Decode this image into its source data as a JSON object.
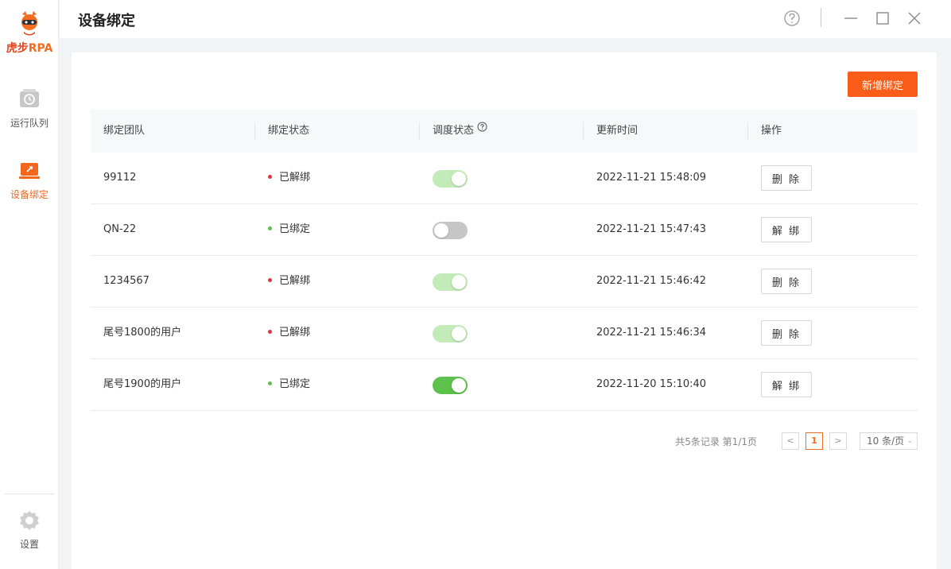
{
  "app": {
    "logo_text_a": "虎步",
    "logo_text_b": "RPA"
  },
  "sidebar": {
    "items": [
      {
        "label": "运行队列",
        "icon": "clock-icon"
      },
      {
        "label": "设备绑定",
        "icon": "laptop-icon",
        "active": true
      }
    ],
    "settings_label": "设置"
  },
  "header": {
    "title": "设备绑定"
  },
  "toolbar": {
    "add_label": "新增绑定"
  },
  "table": {
    "columns": [
      "绑定团队",
      "绑定状态",
      "调度状态",
      "更新时间",
      "操作"
    ],
    "rows": [
      {
        "team": "99112",
        "status": "已解绑",
        "status_color": "#e5323e",
        "schedule": "on-disabled",
        "updated": "2022-11-21 15:48:09",
        "action": "删 除"
      },
      {
        "team": "QN-22",
        "status": "已绑定",
        "status_color": "#5cc24b",
        "schedule": "off",
        "updated": "2022-11-21 15:47:43",
        "action": "解 绑"
      },
      {
        "team": "1234567",
        "status": "已解绑",
        "status_color": "#e5323e",
        "schedule": "on-disabled",
        "updated": "2022-11-21 15:46:42",
        "action": "删 除"
      },
      {
        "team": "尾号1800的用户",
        "status": "已解绑",
        "status_color": "#e5323e",
        "schedule": "on-disabled",
        "updated": "2022-11-21 15:46:34",
        "action": "删 除"
      },
      {
        "team": "尾号1900的用户",
        "status": "已绑定",
        "status_color": "#5cc24b",
        "schedule": "on",
        "updated": "2022-11-20 15:10:40",
        "action": "解 绑"
      }
    ]
  },
  "pagination": {
    "info": "共5条记录 第1/1页",
    "prev": "<",
    "current": "1",
    "next": ">",
    "page_size": "10 条/页"
  },
  "colors": {
    "accent": "#fa5d17",
    "toggle_on": "#5cc24b",
    "toggle_on_disabled": "#c3ebb8",
    "toggle_off": "#c6c6c6"
  }
}
